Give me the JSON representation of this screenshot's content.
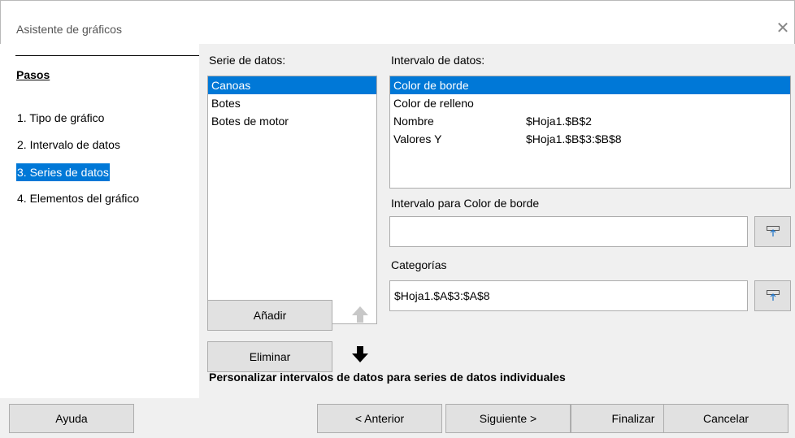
{
  "window": {
    "title": "Asistente de gráficos",
    "close_glyph": "✕"
  },
  "steps": {
    "heading": "Pasos",
    "items": [
      {
        "label": "1. Tipo de gráfico",
        "selected": false
      },
      {
        "label": "2. Intervalo de datos",
        "selected": false
      },
      {
        "label": "3. Series de datos",
        "selected": true
      },
      {
        "label": "4. Elementos del gráfico",
        "selected": false
      }
    ]
  },
  "series": {
    "label": "Serie de datos:",
    "items": [
      {
        "label": "Canoas",
        "selected": true
      },
      {
        "label": "Botes",
        "selected": false
      },
      {
        "label": "Botes de motor",
        "selected": false
      }
    ],
    "add_label": "Añadir",
    "remove_label": "Eliminar",
    "up_icon": "arrow-up-icon",
    "down_icon": "arrow-down-icon"
  },
  "data_ranges": {
    "label": "Intervalo de datos:",
    "rows": [
      {
        "role": "Color de borde",
        "range": "",
        "selected": true
      },
      {
        "role": "Color de relleno",
        "range": "",
        "selected": false
      },
      {
        "role": "Nombre",
        "range": "$Hoja1.$B$2",
        "selected": false
      },
      {
        "role": "Valores Y",
        "range": "$Hoja1.$B$3:$B$8",
        "selected": false
      }
    ]
  },
  "border_range": {
    "label": "Intervalo para Color de borde",
    "value": ""
  },
  "categories": {
    "label": "Categorías",
    "value": "$Hoja1.$A$3:$A$8"
  },
  "hint": "Personalizar intervalos de datos para series de datos individuales",
  "buttons": {
    "help": "Ayuda",
    "back": "< Anterior",
    "next": "Siguiente >",
    "finish": "Finalizar",
    "cancel": "Cancelar"
  },
  "colors": {
    "selection": "#0078d7",
    "panel": "#f0f0f0",
    "button": "#e1e1e1"
  }
}
